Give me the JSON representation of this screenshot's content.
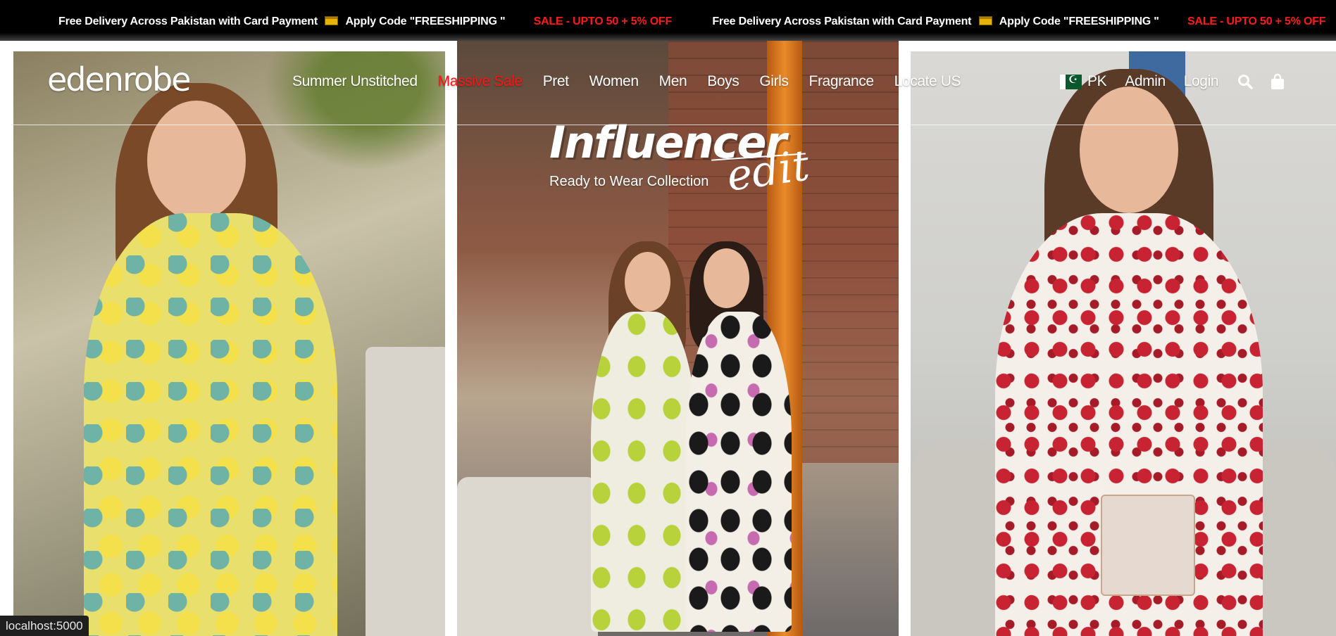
{
  "announcement": {
    "delivery": "Free Delivery Across Pakistan with Card Payment",
    "code": "Apply Code \"FREESHIPPING \"",
    "sale": "SALE - UPTO 50 + 5% OFF"
  },
  "brand": {
    "logo_text": "edenrobe"
  },
  "nav": {
    "items": [
      "Summer Unstitched",
      "Massive Sale",
      "Pret",
      "Women",
      "Men",
      "Boys",
      "Girls",
      "Fragrance",
      "Locate US"
    ],
    "sale_color": "#ff1414"
  },
  "utility": {
    "country": "PK",
    "admin": "Admin",
    "login": "Login",
    "icons": [
      "pakistan-flag-icon",
      "search-icon",
      "shopping-bag-icon"
    ]
  },
  "hero": {
    "title": "Influencer",
    "script": "edit",
    "subtitle": "Ready to Wear Collection"
  },
  "statusbar": {
    "url": "localhost:5000"
  }
}
